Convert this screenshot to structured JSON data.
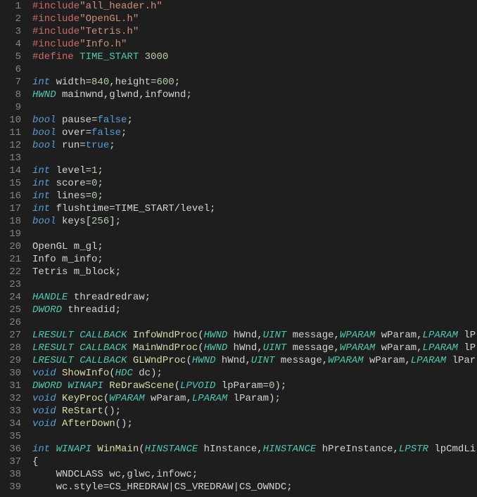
{
  "lines": [
    {
      "n": "1",
      "tokens": [
        [
          "c-preproc",
          "#include"
        ],
        [
          "c-string",
          "\"all_header.h\""
        ]
      ]
    },
    {
      "n": "2",
      "tokens": [
        [
          "c-preproc",
          "#include"
        ],
        [
          "c-string",
          "\"OpenGL.h\""
        ]
      ]
    },
    {
      "n": "3",
      "tokens": [
        [
          "c-preproc",
          "#include"
        ],
        [
          "c-string",
          "\"Tetris.h\""
        ]
      ]
    },
    {
      "n": "4",
      "tokens": [
        [
          "c-preproc",
          "#include"
        ],
        [
          "c-string",
          "\"Info.h\""
        ]
      ]
    },
    {
      "n": "5",
      "tokens": [
        [
          "c-define",
          "#define "
        ],
        [
          "c-macro",
          "TIME_START "
        ],
        [
          "c-num",
          "3000"
        ]
      ]
    },
    {
      "n": "6",
      "tokens": []
    },
    {
      "n": "7",
      "tokens": [
        [
          "c-type",
          "int "
        ],
        [
          "c-ident",
          "width="
        ],
        [
          "c-num",
          "840"
        ],
        [
          "c-ident",
          ",height="
        ],
        [
          "c-num",
          "600"
        ],
        [
          "c-ident",
          ";"
        ]
      ]
    },
    {
      "n": "8",
      "tokens": [
        [
          "c-type-up",
          "HWND "
        ],
        [
          "c-ident",
          "mainwnd,glwnd,infownd;"
        ]
      ]
    },
    {
      "n": "9",
      "tokens": []
    },
    {
      "n": "10",
      "tokens": [
        [
          "c-type",
          "bool "
        ],
        [
          "c-ident",
          "pause="
        ],
        [
          "c-bool",
          "false"
        ],
        [
          "c-ident",
          ";"
        ]
      ]
    },
    {
      "n": "11",
      "tokens": [
        [
          "c-type",
          "bool "
        ],
        [
          "c-ident",
          "over="
        ],
        [
          "c-bool",
          "false"
        ],
        [
          "c-ident",
          ";"
        ]
      ]
    },
    {
      "n": "12",
      "tokens": [
        [
          "c-type",
          "bool "
        ],
        [
          "c-ident",
          "run="
        ],
        [
          "c-bool",
          "true"
        ],
        [
          "c-ident",
          ";"
        ]
      ]
    },
    {
      "n": "13",
      "tokens": []
    },
    {
      "n": "14",
      "tokens": [
        [
          "c-type",
          "int "
        ],
        [
          "c-ident",
          "level="
        ],
        [
          "c-num",
          "1"
        ],
        [
          "c-ident",
          ";"
        ]
      ]
    },
    {
      "n": "15",
      "tokens": [
        [
          "c-type",
          "int "
        ],
        [
          "c-ident",
          "score="
        ],
        [
          "c-num",
          "0"
        ],
        [
          "c-ident",
          ";"
        ]
      ]
    },
    {
      "n": "16",
      "tokens": [
        [
          "c-type",
          "int "
        ],
        [
          "c-ident",
          "lines="
        ],
        [
          "c-num",
          "0"
        ],
        [
          "c-ident",
          ";"
        ]
      ]
    },
    {
      "n": "17",
      "tokens": [
        [
          "c-type",
          "int "
        ],
        [
          "c-ident",
          "flushtime=TIME_START/level;"
        ]
      ]
    },
    {
      "n": "18",
      "tokens": [
        [
          "c-type",
          "bool "
        ],
        [
          "c-ident",
          "keys["
        ],
        [
          "c-num",
          "256"
        ],
        [
          "c-ident",
          "];"
        ]
      ]
    },
    {
      "n": "19",
      "tokens": []
    },
    {
      "n": "20",
      "tokens": [
        [
          "c-ident",
          "OpenGL m_gl;"
        ]
      ]
    },
    {
      "n": "21",
      "tokens": [
        [
          "c-ident",
          "Info m_info;"
        ]
      ]
    },
    {
      "n": "22",
      "tokens": [
        [
          "c-ident",
          "Tetris m_block;"
        ]
      ]
    },
    {
      "n": "23",
      "tokens": []
    },
    {
      "n": "24",
      "tokens": [
        [
          "c-type-up",
          "HANDLE "
        ],
        [
          "c-ident",
          "threadredraw;"
        ]
      ]
    },
    {
      "n": "25",
      "tokens": [
        [
          "c-type-up",
          "DWORD "
        ],
        [
          "c-ident",
          "threadid;"
        ]
      ]
    },
    {
      "n": "26",
      "tokens": []
    },
    {
      "n": "27",
      "tokens": [
        [
          "c-type-up",
          "LRESULT CALLBACK "
        ],
        [
          "c-func",
          "InfoWndProc"
        ],
        [
          "c-paren",
          "("
        ],
        [
          "c-type-up",
          "HWND "
        ],
        [
          "c-ident",
          "hWnd,"
        ],
        [
          "c-type-up",
          "UINT "
        ],
        [
          "c-ident",
          "message,"
        ],
        [
          "c-type-up",
          "WPARAM "
        ],
        [
          "c-ident",
          "wParam,"
        ],
        [
          "c-type-up",
          "LPARAM "
        ],
        [
          "c-ident",
          "lP"
        ]
      ]
    },
    {
      "n": "28",
      "tokens": [
        [
          "c-type-up",
          "LRESULT CALLBACK "
        ],
        [
          "c-func",
          "MainWndProc"
        ],
        [
          "c-paren",
          "("
        ],
        [
          "c-type-up",
          "HWND "
        ],
        [
          "c-ident",
          "hWnd,"
        ],
        [
          "c-type-up",
          "UINT "
        ],
        [
          "c-ident",
          "message,"
        ],
        [
          "c-type-up",
          "WPARAM "
        ],
        [
          "c-ident",
          "wParam,"
        ],
        [
          "c-type-up",
          "LPARAM "
        ],
        [
          "c-ident",
          "lP"
        ]
      ]
    },
    {
      "n": "29",
      "tokens": [
        [
          "c-type-up",
          "LRESULT CALLBACK "
        ],
        [
          "c-func",
          "GLWndProc"
        ],
        [
          "c-paren",
          "("
        ],
        [
          "c-type-up",
          "HWND "
        ],
        [
          "c-ident",
          "hWnd,"
        ],
        [
          "c-type-up",
          "UINT "
        ],
        [
          "c-ident",
          "message,"
        ],
        [
          "c-type-up",
          "WPARAM "
        ],
        [
          "c-ident",
          "wParam,"
        ],
        [
          "c-type-up",
          "LPARAM "
        ],
        [
          "c-ident",
          "lPar"
        ]
      ]
    },
    {
      "n": "30",
      "tokens": [
        [
          "c-type",
          "void "
        ],
        [
          "c-func",
          "ShowInfo"
        ],
        [
          "c-paren",
          "("
        ],
        [
          "c-type-up",
          "HDC "
        ],
        [
          "c-ident",
          "dc"
        ],
        [
          "c-paren",
          ")"
        ],
        [
          "c-ident",
          ";"
        ]
      ]
    },
    {
      "n": "31",
      "tokens": [
        [
          "c-type-up",
          "DWORD WINAPI "
        ],
        [
          "c-func",
          "ReDrawScene"
        ],
        [
          "c-paren",
          "("
        ],
        [
          "c-type-up",
          "LPVOID "
        ],
        [
          "c-ident",
          "lpParam="
        ],
        [
          "c-num",
          "0"
        ],
        [
          "c-paren",
          ")"
        ],
        [
          "c-ident",
          ";"
        ]
      ]
    },
    {
      "n": "32",
      "tokens": [
        [
          "c-type",
          "void "
        ],
        [
          "c-func",
          "KeyProc"
        ],
        [
          "c-paren",
          "("
        ],
        [
          "c-type-up",
          "WPARAM "
        ],
        [
          "c-ident",
          "wParam,"
        ],
        [
          "c-type-up",
          "LPARAM "
        ],
        [
          "c-ident",
          "lParam"
        ],
        [
          "c-paren",
          ")"
        ],
        [
          "c-ident",
          ";"
        ]
      ]
    },
    {
      "n": "33",
      "tokens": [
        [
          "c-type",
          "void "
        ],
        [
          "c-func",
          "ReStart"
        ],
        [
          "c-paren",
          "()"
        ],
        [
          "c-ident",
          ";"
        ]
      ]
    },
    {
      "n": "34",
      "tokens": [
        [
          "c-type",
          "void "
        ],
        [
          "c-func",
          "AfterDown"
        ],
        [
          "c-paren",
          "()"
        ],
        [
          "c-ident",
          ";"
        ]
      ]
    },
    {
      "n": "35",
      "tokens": []
    },
    {
      "n": "36",
      "tokens": [
        [
          "c-type",
          "int "
        ],
        [
          "c-type-up",
          "WINAPI "
        ],
        [
          "c-func",
          "WinMain"
        ],
        [
          "c-paren",
          "("
        ],
        [
          "c-type-up",
          "HINSTANCE "
        ],
        [
          "c-ident",
          "hInstance,"
        ],
        [
          "c-type-up",
          "HINSTANCE "
        ],
        [
          "c-ident",
          "hPreInstance,"
        ],
        [
          "c-type-up",
          "LPSTR "
        ],
        [
          "c-ident",
          "lpCmdLi"
        ]
      ]
    },
    {
      "n": "37",
      "tokens": [
        [
          "c-paren",
          "{"
        ]
      ]
    },
    {
      "n": "38",
      "tokens": [
        [
          "c-ident",
          "    WNDCLASS wc,glwc,infowc;"
        ]
      ]
    },
    {
      "n": "39",
      "tokens": [
        [
          "c-ident",
          "    wc.style=CS_HREDRAW|CS_VREDRAW|CS_OWNDC;"
        ]
      ]
    }
  ]
}
